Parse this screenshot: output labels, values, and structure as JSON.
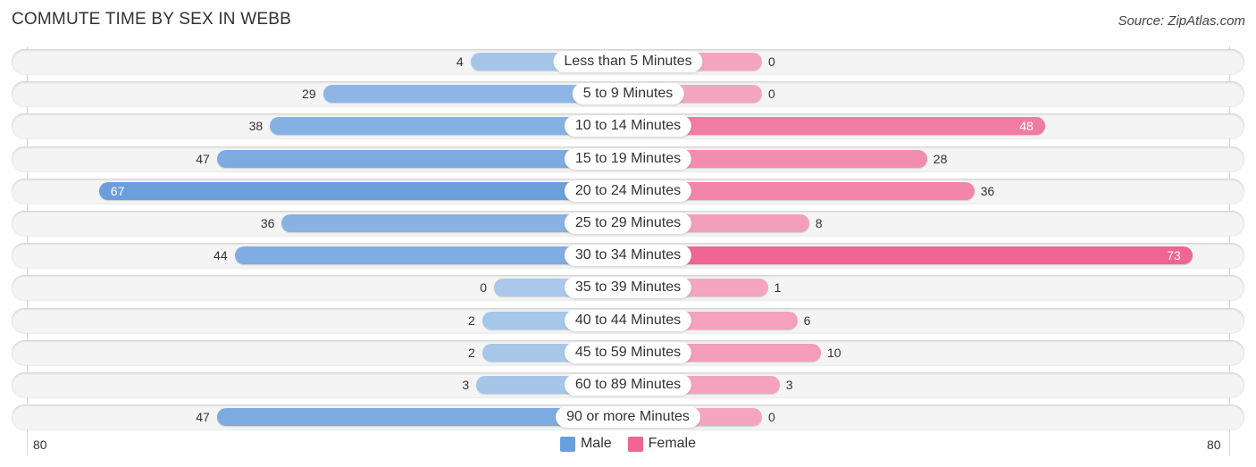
{
  "header": {
    "title": "COMMUTE TIME BY SEX IN WEBB",
    "source": "Source: ZipAtlas.com"
  },
  "colors": {
    "male": "#6a9fdc",
    "male_light": "#a9c8ea",
    "female": "#f06591",
    "female_light": "#f5a6bf"
  },
  "chart_data": {
    "type": "bar",
    "orientation": "horizontal-diverging",
    "title": "COMMUTE TIME BY SEX IN WEBB",
    "categories": [
      "Less than 5 Minutes",
      "5 to 9 Minutes",
      "10 to 14 Minutes",
      "15 to 19 Minutes",
      "20 to 24 Minutes",
      "25 to 29 Minutes",
      "30 to 34 Minutes",
      "35 to 39 Minutes",
      "40 to 44 Minutes",
      "45 to 59 Minutes",
      "60 to 89 Minutes",
      "90 or more Minutes"
    ],
    "series": [
      {
        "name": "Male",
        "values": [
          4,
          29,
          38,
          47,
          67,
          36,
          44,
          0,
          2,
          2,
          3,
          47
        ]
      },
      {
        "name": "Female",
        "values": [
          0,
          0,
          48,
          28,
          36,
          8,
          73,
          1,
          6,
          10,
          3,
          0
        ]
      }
    ],
    "axis_min_label": "80",
    "axis_max_label": "80",
    "xlim": [
      -80,
      80
    ],
    "legend": [
      "Male",
      "Female"
    ],
    "legend_position": "bottom-center",
    "grid": false
  }
}
